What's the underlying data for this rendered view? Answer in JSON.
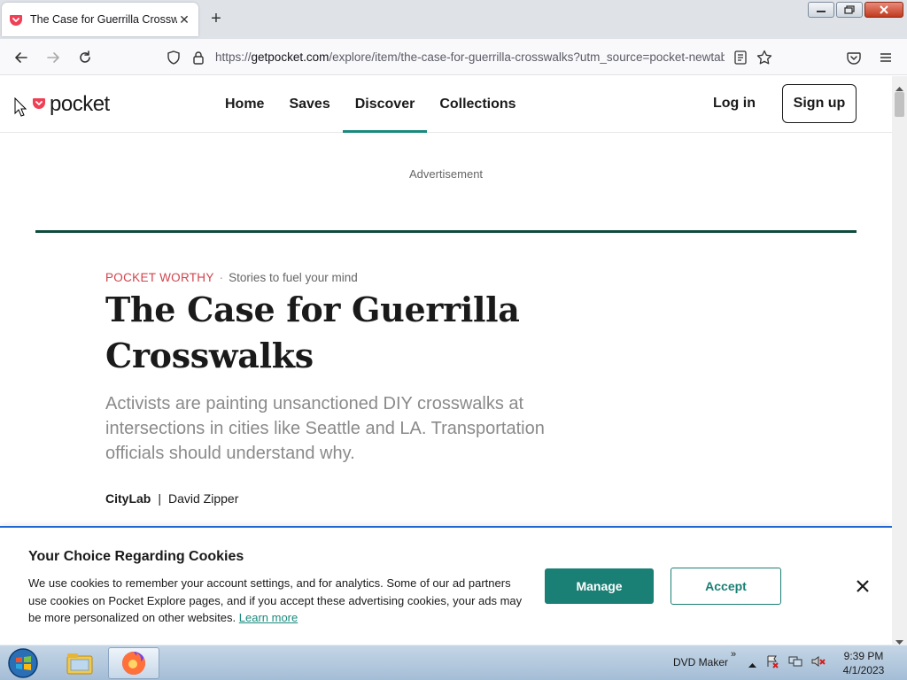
{
  "browser": {
    "tab": {
      "title": "The Case for Guerrilla Crosswalks",
      "favicon": "pocket-icon"
    },
    "url": {
      "scheme": "https://",
      "host": "getpocket.com",
      "path": "/explore/item/the-case-for-guerrilla-crosswalks?utm_source=pocket-newtab"
    }
  },
  "site": {
    "logo": "pocket",
    "nav": [
      "Home",
      "Saves",
      "Discover",
      "Collections"
    ],
    "active_nav": "Discover",
    "login": "Log in",
    "signup": "Sign up",
    "brand_color": "#ef4056",
    "accent_color": "#1a8a7d"
  },
  "article": {
    "advert": "Advertisement",
    "kicker": "POCKET WORTHY",
    "kicker_sub": "Stories to fuel your mind",
    "title": "The Case for Guerrilla Crosswalks",
    "dek": "Activists are painting unsanctioned DIY crosswalks at intersections in cities like Seattle and LA. Transportation officials should understand why.",
    "publisher": "CityLab",
    "author": "David Zipper"
  },
  "cookie": {
    "title": "Your Choice Regarding Cookies",
    "body": "We use cookies to remember your account settings, and for analytics. Some of our ad partners use cookies on Pocket Explore pages, and if you accept these advertising cookies, your ads may be more personalized on other websites.",
    "link": "Learn more",
    "manage": "Manage",
    "accept": "Accept"
  },
  "taskbar": {
    "label": "DVD Maker",
    "time": "9:39 PM",
    "date": "4/1/2023"
  }
}
